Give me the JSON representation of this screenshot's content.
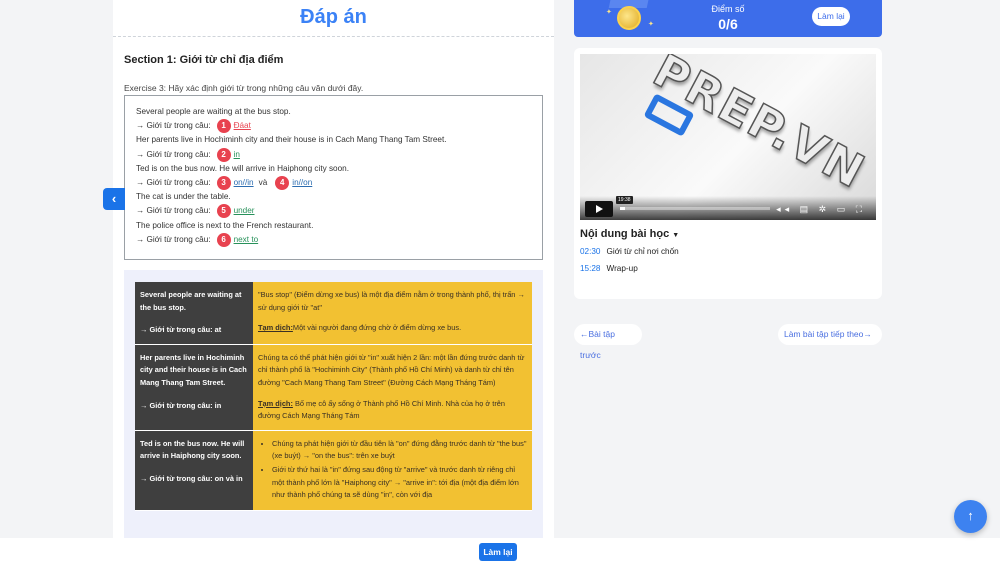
{
  "answer_title": "Đáp án",
  "section_title": "Section 1: Giới từ chỉ địa điểm",
  "exercise_prompt": "Exercise 3: Hãy xác định giới từ trong những câu văn dưới đây.",
  "answer_prefix": "→ Giới từ trong câu:",
  "conjunction": "và",
  "exercise": [
    {
      "sentence": "Several people are waiting at the bus stop.",
      "num1": "1",
      "ans1": "Đáat",
      "status": "wrong"
    },
    {
      "sentence": "Her parents live in Hochiminh city and their house is in Cach Mang Thang Tam Street.",
      "num1": "2",
      "ans1": "in",
      "status": "correct"
    },
    {
      "sentence": "Ted is on the bus now. He will arrive in Haiphong city soon.",
      "num1": "3",
      "ans1": "on//in",
      "num2": "4",
      "ans2": "in//on",
      "status": "alt"
    },
    {
      "sentence": "The cat is under the table.",
      "num1": "5",
      "ans1": "under",
      "status": "correct"
    },
    {
      "sentence": "The police office is next to the French restaurant.",
      "num1": "6",
      "ans1": "next to",
      "status": "correct"
    }
  ],
  "explanations": [
    {
      "sentence": "Several people are waiting at the bus stop.",
      "answer": "→ Giới từ trong câu: at",
      "explain": "\"Bus stop\" (Điểm dừng xe bus) là một địa điểm nằm ở trong thành phố, thị trấn → sử dụng giới từ \"at\"",
      "translation_label": "Tạm dịch:",
      "translation": "Một vài người đang đứng chờ ở điểm dừng xe bus."
    },
    {
      "sentence": "Her parents live in Hochiminh city and their house is in Cach Mang Thang Tam Street.",
      "answer": "→ Giới từ trong câu: in",
      "explain": "Chúng ta có thể phát hiện giới từ \"in\" xuất hiện 2 lần: một lần đứng trước danh từ chỉ thành phố là \"Hochiminh City\" (Thành phố Hồ Chí Minh) và danh từ chỉ tên đường \"Cach Mang Thang Tam Street\" (Đường Cách Mạng Tháng Tám)",
      "translation_label": "Tạm dịch:",
      "translation": "Bố mẹ cô ấy sống ở Thành phố Hồ Chí Minh. Nhà của họ ở trên đường Cách Mạng Tháng Tám"
    },
    {
      "sentence": "Ted is on the bus now. He will arrive in Haiphong city soon.",
      "answer": "→ Giới từ trong câu: on và in",
      "bullets": [
        "Chúng ta phát hiện giới từ đầu tiên là \"on\" đứng đằng trước danh từ \"the bus\" (xe buýt) → \"on the bus\": trên xe buýt",
        "Giới từ thứ hai là \"in\" đứng sau động từ \"arrive\" và trước danh từ riêng chỉ một thành phố lớn là \"Haiphong city\" → \"arrive in\": tới địa (một địa điểm lớn như thành phố chúng ta sẽ dùng \"in\", còn với địa"
      ]
    }
  ],
  "score": {
    "label": "Điểm số",
    "value": "0/6",
    "retry": "Làm lại"
  },
  "video": {
    "logo_text": "PREP.VN",
    "time_tooltip": "19:38"
  },
  "lesson": {
    "heading": "Nội dung bài học",
    "items": [
      {
        "time": "02:30",
        "title": "Giới từ chỉ nơi chốn"
      },
      {
        "time": "15:28",
        "title": "Wrap-up"
      }
    ]
  },
  "nav": {
    "prev": "←Bài tập trước",
    "next": "Làm bài tập tiếp theo→"
  },
  "bottom_retry": "Làm lại",
  "colors": {
    "primary": "#1a73e8",
    "wrong": "#e8424f",
    "correct": "#27915a",
    "explain_bg": "#f2c132",
    "sentence_bg": "#3f3f3f"
  },
  "icons": {
    "toggle": "chevron-left-icon",
    "scroll_top": "arrow-up-icon",
    "medal": "medal-icon",
    "play": "play-icon"
  }
}
